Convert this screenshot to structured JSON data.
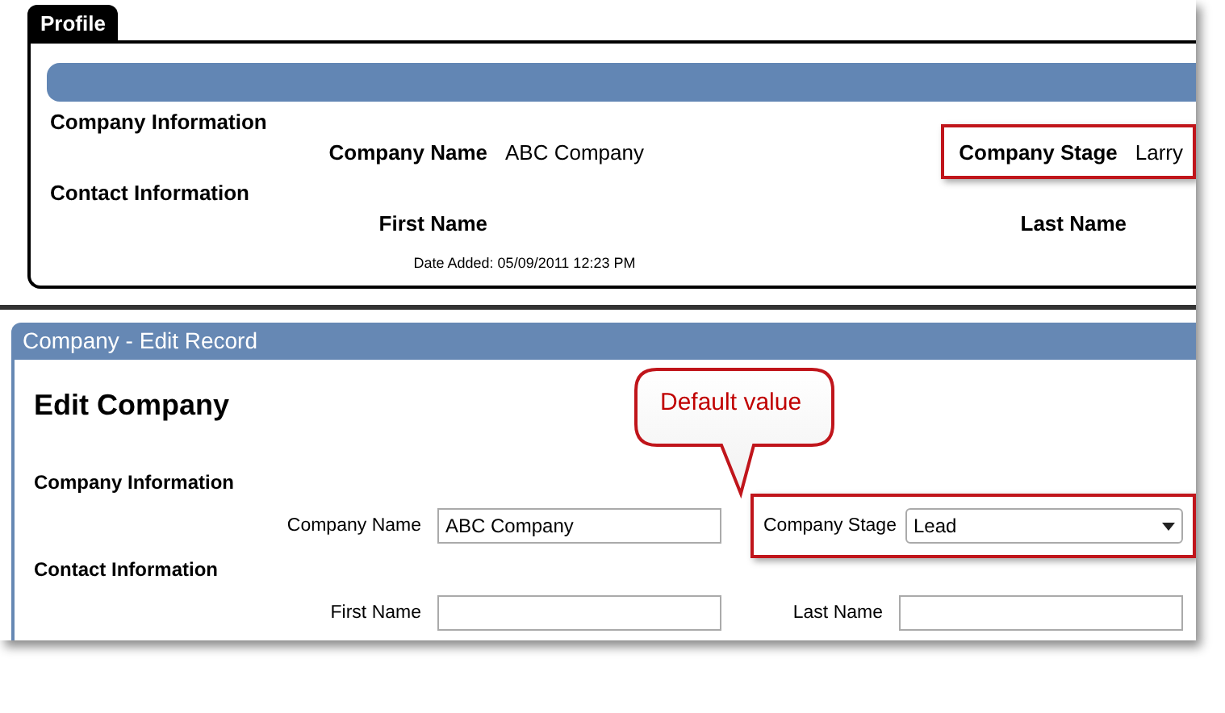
{
  "profile": {
    "tab": "Profile",
    "sections": [
      {
        "title": "Company Information",
        "fields": [
          {
            "label": "Company Name",
            "value": "ABC Company",
            "highlighted": false
          },
          {
            "label": "Company Stage",
            "value": "Larry",
            "highlighted": true
          }
        ]
      },
      {
        "title": "Contact Information",
        "fields": [
          {
            "label": "First Name",
            "highlighted": false
          },
          {
            "label": "Last Name",
            "highlighted": false
          }
        ]
      }
    ],
    "date_added": "Date Added: 05/09/2011 12:23 PM"
  },
  "edit_record": {
    "title": "Company - Edit Record",
    "heading": "Edit Company",
    "sections": [
      {
        "title": "Company Information",
        "fields": [
          {
            "label": "Company Name",
            "kind": "text",
            "value": "ABC Company",
            "highlighted": false
          },
          {
            "label": "Company Stage",
            "kind": "select",
            "value": "Lead",
            "highlighted": true
          }
        ]
      },
      {
        "title": "Contact Information",
        "fields": [
          {
            "label": "First Name",
            "kind": "text",
            "highlighted": false
          },
          {
            "label": "Last Name",
            "kind": "text",
            "highlighted": false
          }
        ]
      }
    ],
    "callout": "Default value"
  }
}
